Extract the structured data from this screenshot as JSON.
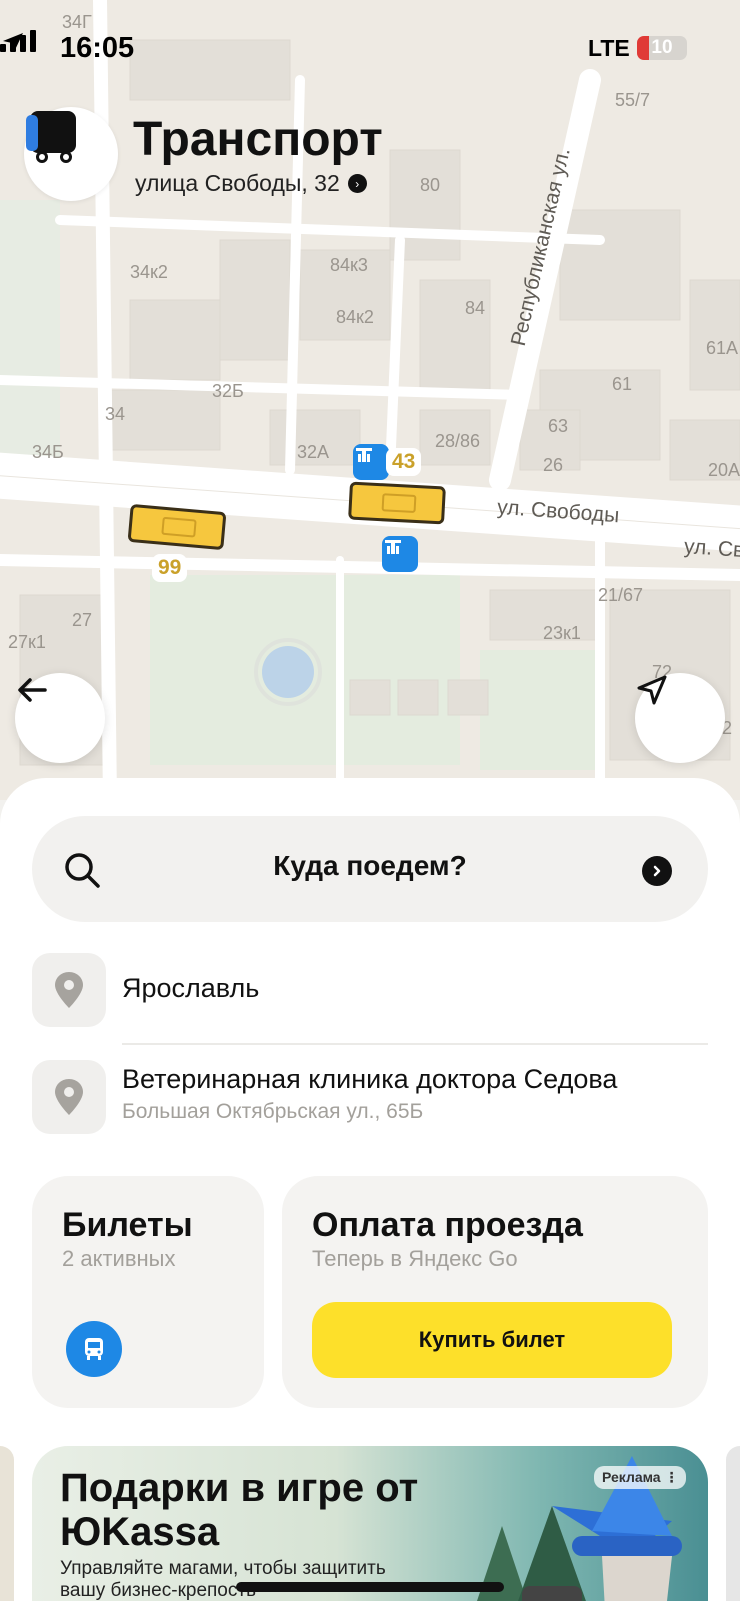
{
  "status_bar": {
    "time": "16:05",
    "network": "LTE",
    "battery": "10"
  },
  "header": {
    "title": "Транспорт",
    "subtitle": "улица Свободы, 32"
  },
  "map": {
    "house_numbers": [
      "34Г",
      "80",
      "55/7",
      "34к2",
      "84к3",
      "84к2",
      "84",
      "61А",
      "61",
      "32Б",
      "34",
      "34Б",
      "32А",
      "28/86",
      "63",
      "26",
      "20А",
      "27",
      "27к1",
      "21/67",
      "23к1",
      "72",
      "2"
    ],
    "streets": [
      "Республиканская ул.",
      "ул. Свободы",
      "ул. Св"
    ],
    "route_badges": [
      "43",
      "99"
    ]
  },
  "search": {
    "placeholder": "Куда поедем?"
  },
  "recent": [
    {
      "title": "Ярославль",
      "subtitle": ""
    },
    {
      "title": "Ветеринарная клиника доктора Седова",
      "subtitle": "Большая Октябрьская ул., 65Б"
    }
  ],
  "tickets_card": {
    "title": "Билеты",
    "subtitle": "2 активных"
  },
  "payment_card": {
    "title": "Оплата проезда",
    "subtitle": "Теперь в Яндекс Go",
    "button": "Купить билет"
  },
  "ad": {
    "title": "Подарки в игре от ЮKassa",
    "text": "Управляйте магами, чтобы защитить вашу бизнес-крепость",
    "tag": "Реклама ⋮"
  },
  "colors": {
    "accent_yellow": "#fde02a",
    "stop_blue": "#1e88e5",
    "bus_yellow": "#f6c73e"
  }
}
